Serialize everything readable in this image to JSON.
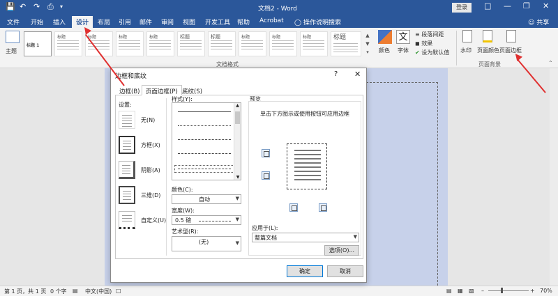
{
  "window": {
    "title": "文档2 - Word",
    "login_label": "登录"
  },
  "tabs": [
    "文件",
    "开始",
    "插入",
    "设计",
    "布局",
    "引用",
    "邮件",
    "审阅",
    "视图",
    "开发工具",
    "帮助",
    "Acrobat"
  ],
  "active_tab": "设计",
  "tell_me": "操作说明搜索",
  "share": "共享",
  "ribbon": {
    "theme_label": "主题",
    "style_thumb_title": "标题",
    "style_thumb_title1": "标题 1",
    "big_title": "标题",
    "colors_label": "颜色",
    "fonts_label": "字体",
    "paragraph_spacing": "段落间距",
    "effects": "效果",
    "set_default": "设为默认值",
    "doc_format_group": "文档格式",
    "watermark": "水印",
    "page_color": "页面颜色",
    "page_borders": "页面边框",
    "page_background_group": "页面背景"
  },
  "dialog": {
    "title": "边框和底纹",
    "help": "?",
    "tabs": [
      "边框(B)",
      "页面边框(P)",
      "底纹(S)"
    ],
    "active_tab": "页面边框(P)",
    "setting_label": "设置:",
    "settings": [
      "无(N)",
      "方框(X)",
      "阴影(A)",
      "三维(D)",
      "自定义(U)"
    ],
    "selected_setting": "方框(X)",
    "style_label": "样式(Y):",
    "color_label": "颜色(C):",
    "color_value": "自动",
    "width_label": "宽度(W):",
    "width_value": "0.5 磅",
    "art_label": "艺术型(R):",
    "art_value": "(无)",
    "preview_label": "预览",
    "preview_hint": "单击下方图示或使用按钮可应用边框",
    "apply_to_label": "应用于(L):",
    "apply_to_value": "整篇文档",
    "options_button": "选项(O)...",
    "ok_button": "确定",
    "cancel_button": "取消"
  },
  "status": {
    "page": "第 1 页，共 1 页",
    "words": "0 个字",
    "language": "中文(中国)",
    "zoom": "70%"
  },
  "colors": {
    "brand": "#2b579a",
    "annotation_arrow": "#e03030",
    "page_tint": "#c7d1ea"
  }
}
